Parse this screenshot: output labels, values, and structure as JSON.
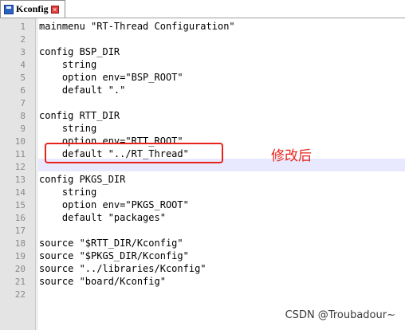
{
  "tab": {
    "label": "Kconfig"
  },
  "lines": [
    {
      "num": "1",
      "text": "mainmenu \"RT-Thread Configuration\""
    },
    {
      "num": "2",
      "text": ""
    },
    {
      "num": "3",
      "text": "config BSP_DIR"
    },
    {
      "num": "4",
      "text": "    string"
    },
    {
      "num": "5",
      "text": "    option env=\"BSP_ROOT\""
    },
    {
      "num": "6",
      "text": "    default \".\""
    },
    {
      "num": "7",
      "text": ""
    },
    {
      "num": "8",
      "text": "config RTT_DIR"
    },
    {
      "num": "9",
      "text": "    string"
    },
    {
      "num": "10",
      "text": "    option env=\"RTT_ROOT\""
    },
    {
      "num": "11",
      "text": "    default \"../RT_Thread\""
    },
    {
      "num": "12",
      "text": ""
    },
    {
      "num": "13",
      "text": "config PKGS_DIR"
    },
    {
      "num": "14",
      "text": "    string"
    },
    {
      "num": "15",
      "text": "    option env=\"PKGS_ROOT\""
    },
    {
      "num": "16",
      "text": "    default \"packages\""
    },
    {
      "num": "17",
      "text": ""
    },
    {
      "num": "18",
      "text": "source \"$RTT_DIR/Kconfig\""
    },
    {
      "num": "19",
      "text": "source \"$PKGS_DIR/Kconfig\""
    },
    {
      "num": "20",
      "text": "source \"../libraries/Kconfig\""
    },
    {
      "num": "21",
      "text": "source \"board/Kconfig\""
    },
    {
      "num": "22",
      "text": ""
    }
  ],
  "annotation": {
    "text": "修改后"
  },
  "watermark": {
    "text": "CSDN @Troubadour~"
  },
  "colors": {
    "annotation": "#e8231c",
    "current_line": "#e8e8ff",
    "gutter": "#e4e4e4"
  },
  "icons": {
    "tab_file": "save-icon",
    "tab_close": "close-icon"
  }
}
